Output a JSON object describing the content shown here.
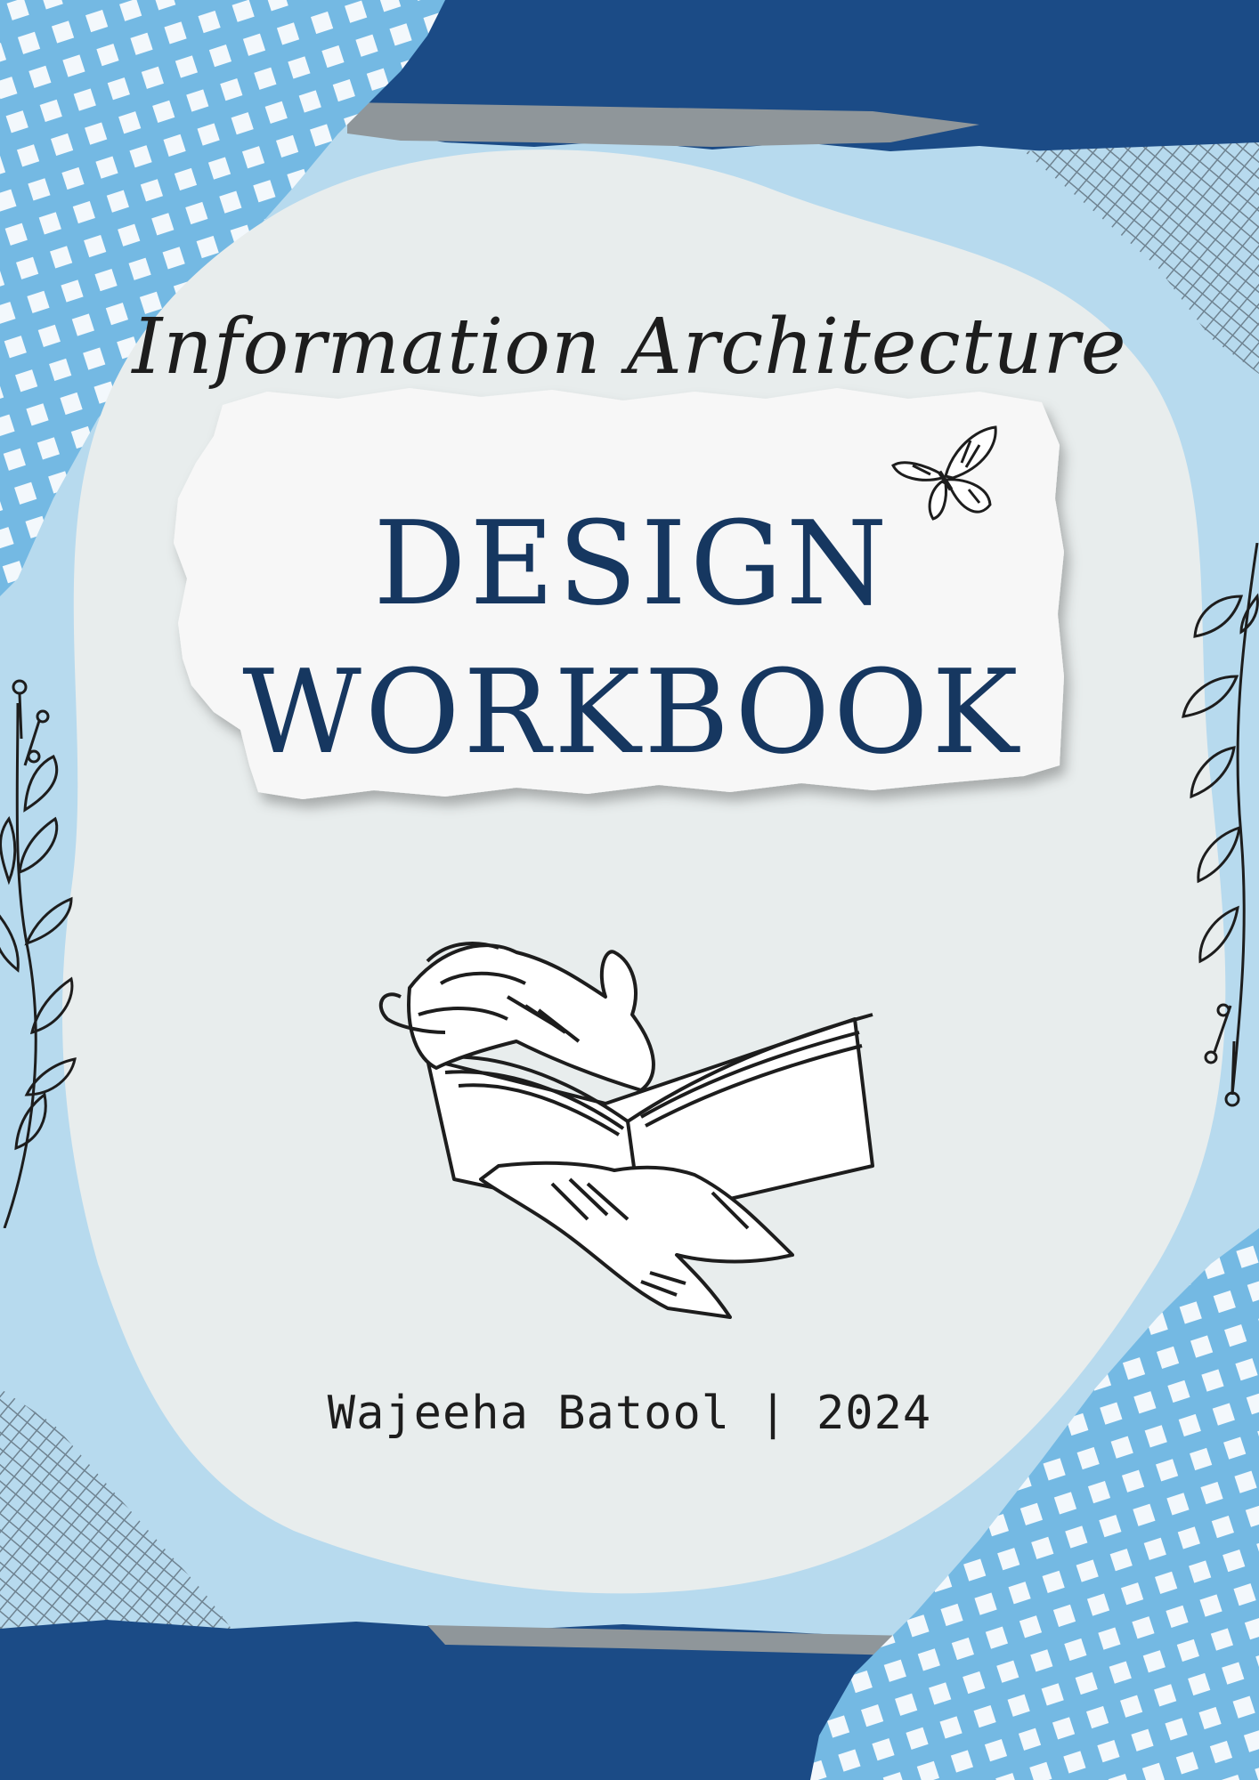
{
  "cover": {
    "subtitle": "Information Architecture",
    "title_line_1": "DESIGN",
    "title_line_2": "WORKBOOK",
    "byline": "Wajeeha Batool | 2024"
  },
  "colors": {
    "title": "#163760",
    "navy_paper": "#1b4b86",
    "light_blue": "#b7daee",
    "gingham_blue": "#74b9e3",
    "center_paper": "#e8eded",
    "torn_paper": "#f7f7f7",
    "ink": "#1d1d1d"
  },
  "icons": [
    "butterfly-icon",
    "reading-hands-book-icon",
    "leaf-branch-icon"
  ]
}
